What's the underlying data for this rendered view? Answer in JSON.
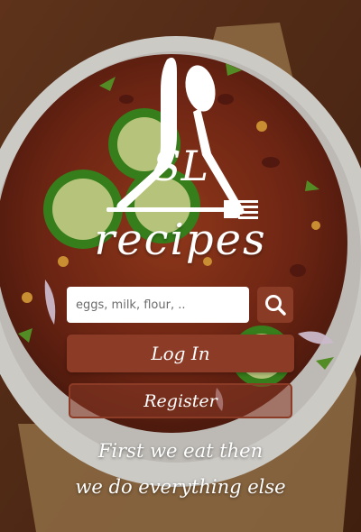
{
  "brand": {
    "logo_letters": "SL",
    "app_name": "recipes"
  },
  "search": {
    "placeholder": "eggs, milk, flour, .."
  },
  "buttons": {
    "login_label": "Log In",
    "register_label": "Register"
  },
  "tagline": {
    "line1": "First we eat then",
    "line2": "we do everything else"
  },
  "colors": {
    "accent": "#8c3b26",
    "text_on_image": "#ffffff",
    "input_bg": "#ffffff"
  },
  "icons": {
    "search": "search-icon",
    "spoon": "spoon-icon",
    "knife": "knife-icon",
    "fork": "fork-icon"
  }
}
